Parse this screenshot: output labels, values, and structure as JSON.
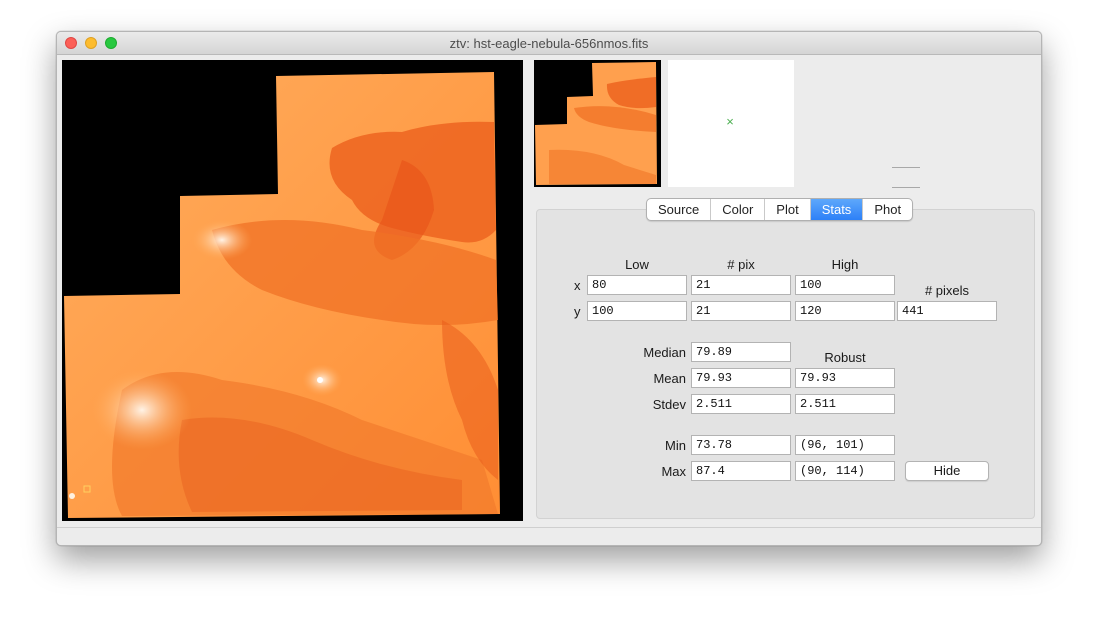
{
  "window": {
    "title": "ztv: hst-eagle-nebula-656nmos.fits"
  },
  "images": {
    "main_alt": "main image display",
    "pan_alt": "pan thumbnail",
    "loupe_alt": "loupe zoom"
  },
  "tabs": [
    {
      "label": "Source",
      "active": false
    },
    {
      "label": "Color",
      "active": false
    },
    {
      "label": "Plot",
      "active": false
    },
    {
      "label": "Stats",
      "active": true
    },
    {
      "label": "Phot",
      "active": false
    }
  ],
  "stats": {
    "col_low": "Low",
    "col_npix": "# pix",
    "col_high": "High",
    "col_npixels": "# pixels",
    "x_label": "x",
    "y_label": "y",
    "x_low": "80",
    "x_npix": "21",
    "x_high": "100",
    "y_low": "100",
    "y_npix": "21",
    "y_high": "120",
    "npixels": "441",
    "robust_label": "Robust",
    "median_label": "Median",
    "median": "79.89",
    "mean_label": "Mean",
    "mean": "79.93",
    "mean_robust": "79.93",
    "stdev_label": "Stdev",
    "stdev": "2.511",
    "stdev_robust": "2.511",
    "min_label": "Min",
    "min": "73.78",
    "min_pos": "(96, 101)",
    "max_label": "Max",
    "max": "87.4",
    "max_pos": "(90, 114)",
    "hide_label": "Hide"
  },
  "colors": {
    "nebula_light": "#ffab5a",
    "nebula_mid": "#ff8a2a",
    "nebula_dark": "#e8561a",
    "tab_active": "#2d80f7"
  },
  "icons": {
    "loupe_marker": "x-marker-icon"
  }
}
